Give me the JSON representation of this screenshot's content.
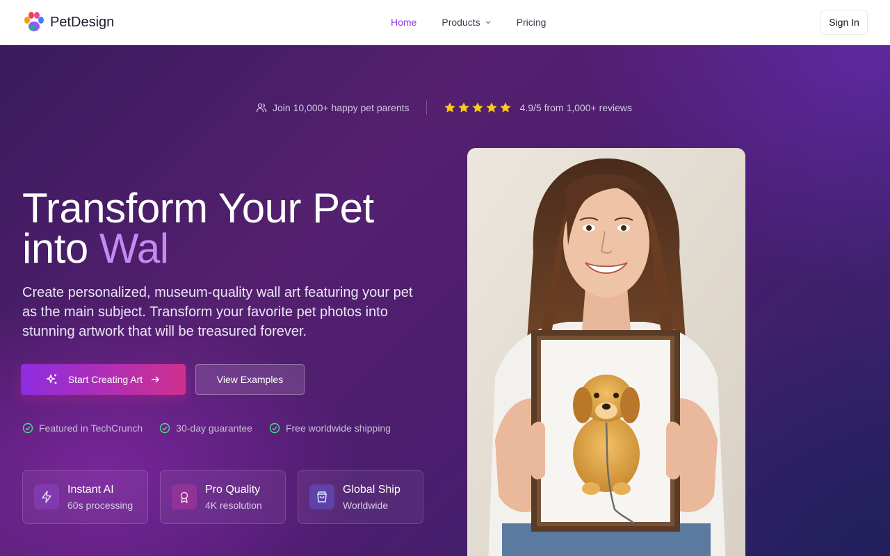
{
  "brand": {
    "name": "PetDesign"
  },
  "nav": {
    "links": [
      {
        "label": "Home",
        "active": true
      },
      {
        "label": "Products",
        "has_dropdown": true
      },
      {
        "label": "Pricing"
      }
    ],
    "sign_in": "Sign In"
  },
  "hero": {
    "social_proof": {
      "parents": "Join 10,000+ happy pet parents",
      "rating_stars": 5,
      "rating": "4.9/5 from 1,000+ reviews"
    },
    "headline_line1": "Transform Your Pet",
    "headline_line2_prefix": "into ",
    "headline_line2_accent": "Wal",
    "subtitle": "Create personalized, museum-quality wall art featuring your pet as the main subject. Transform your favorite pet photos into stunning artwork that will be treasured forever.",
    "primary_cta": "Start Creating Art",
    "secondary_cta": "View Examples",
    "badges": [
      "Featured in TechCrunch",
      "30-day guarantee",
      "Free worldwide shipping"
    ],
    "features": [
      {
        "title": "Instant AI",
        "subtitle": "60s processing",
        "icon": "lightning-icon"
      },
      {
        "title": "Pro Quality",
        "subtitle": "4K resolution",
        "icon": "award-icon"
      },
      {
        "title": "Global Ship",
        "subtitle": "Worldwide",
        "icon": "shopping-bag-icon"
      }
    ]
  },
  "colors": {
    "accent": "#9333ea",
    "headline_accent": "#c58af2",
    "cta_gradient_start": "#8d2de0",
    "cta_gradient_end": "#d0308e",
    "check_green": "#4ade80",
    "star_yellow": "#facc15"
  }
}
